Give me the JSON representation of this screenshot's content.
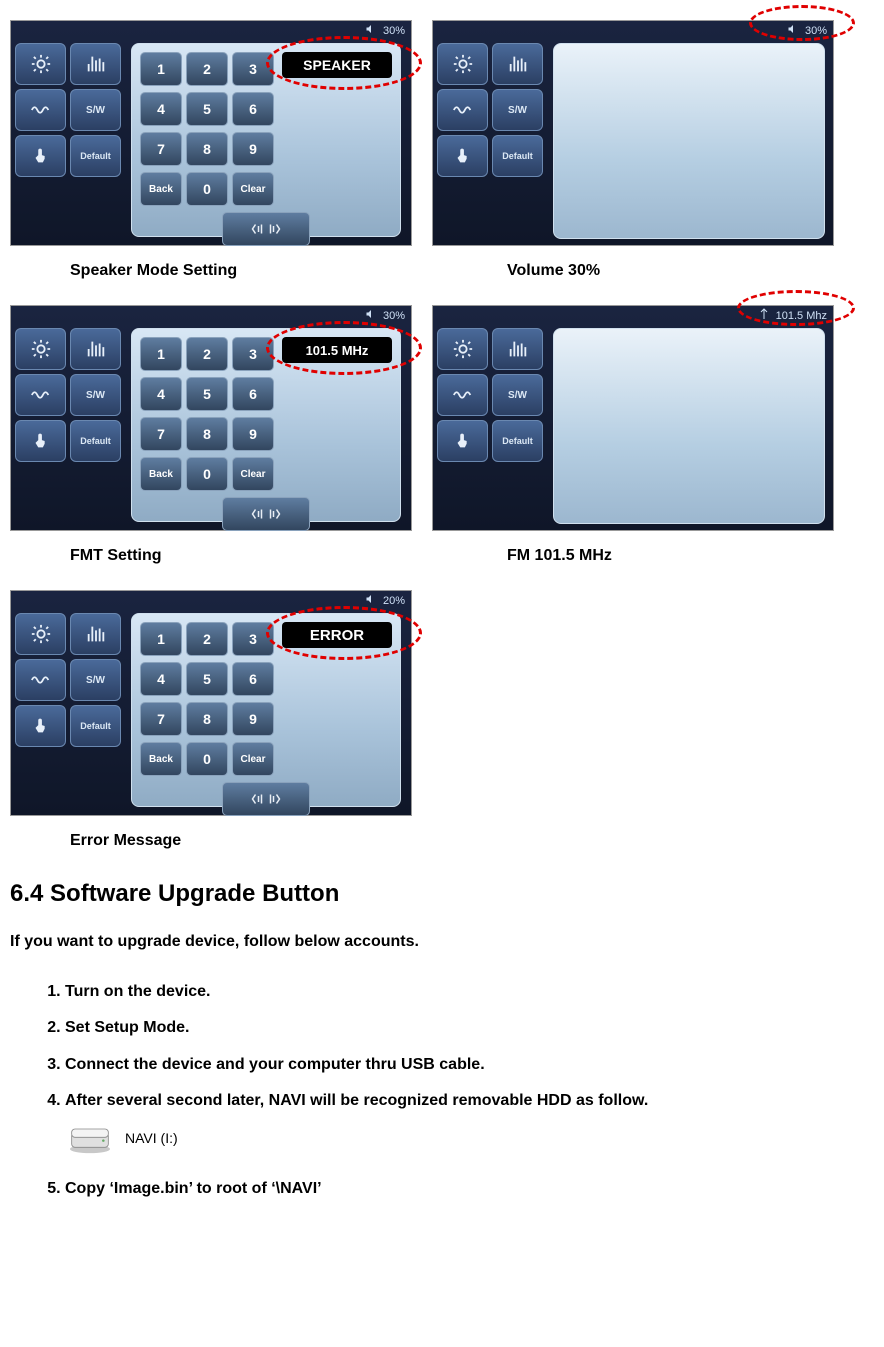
{
  "screens": {
    "speaker": {
      "status_percent": "30%",
      "keypad": [
        "1",
        "2",
        "3",
        "4",
        "5",
        "6",
        "7",
        "8",
        "9",
        "Back",
        "0",
        "Clear"
      ],
      "display": "SPEAKER",
      "sidebar": {
        "default_label": "Default",
        "sw_label": "S/W"
      }
    },
    "volume": {
      "status_percent": "30%",
      "sidebar": {
        "default_label": "Default",
        "sw_label": "S/W"
      }
    },
    "fmt": {
      "status_percent": "30%",
      "keypad": [
        "1",
        "2",
        "3",
        "4",
        "5",
        "6",
        "7",
        "8",
        "9",
        "Back",
        "0",
        "Clear"
      ],
      "display": "101.5 MHz",
      "sidebar": {
        "default_label": "Default",
        "sw_label": "S/W"
      }
    },
    "fmt_status": {
      "status_freq": "101.5 Mhz",
      "sidebar": {
        "default_label": "Default",
        "sw_label": "S/W"
      }
    },
    "error": {
      "status_percent": "20%",
      "keypad": [
        "1",
        "2",
        "3",
        "4",
        "5",
        "6",
        "7",
        "8",
        "9",
        "Back",
        "0",
        "Clear"
      ],
      "display": "ERROR",
      "sidebar": {
        "default_label": "Default",
        "sw_label": "S/W"
      }
    }
  },
  "captions": {
    "speaker": "Speaker Mode Setting",
    "volume": "Volume 30%",
    "fmt": "FMT Setting",
    "fmt_status": "FM 101.5 MHz",
    "error": "Error Message"
  },
  "section_title": "6.4 Software Upgrade Button",
  "intro": "If you want to upgrade device, follow below accounts.",
  "steps": {
    "s1": "Turn on the device.",
    "s2": "Set Setup Mode.",
    "s3": "Connect the device and your computer thru USB cable.",
    "s4": "After several second later, NAVI will be recognized removable HDD as follow.",
    "s5": "Copy ‘Image.bin’ to root of ‘\\NAVI’"
  },
  "drive_label": "NAVI (I:)"
}
